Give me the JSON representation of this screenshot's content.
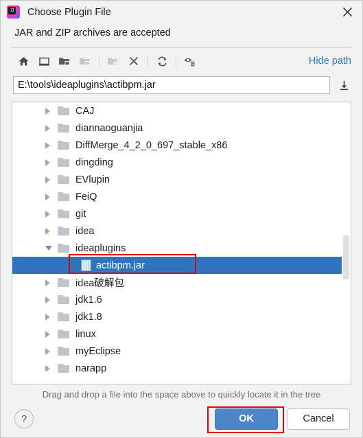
{
  "window": {
    "title": "Choose Plugin File",
    "logo_text": "IJ",
    "close_icon": "close-icon"
  },
  "subtitle": "JAR and ZIP archives are accepted",
  "toolbar": {
    "items": [
      {
        "icon": "home-icon",
        "label": "Home",
        "enabled": true
      },
      {
        "icon": "desktop-icon",
        "label": "Desktop",
        "enabled": true
      },
      {
        "icon": "folder-expand-icon",
        "label": "Expand All",
        "enabled": true
      },
      {
        "icon": "folder-collapse-icon",
        "label": "Collapse All",
        "enabled": false
      },
      {
        "icon": "new-folder-icon",
        "label": "New Folder",
        "enabled": false
      },
      {
        "icon": "delete-icon",
        "label": "Delete",
        "enabled": true
      },
      {
        "icon": "refresh-icon",
        "label": "Refresh",
        "enabled": true
      },
      {
        "icon": "show-hidden-files-icon",
        "label": "Show Hidden Files",
        "enabled": true
      }
    ],
    "hide_path_label": "Hide path"
  },
  "path_field": {
    "value": "E:\\tools\\ideaplugins\\actibpm.jar",
    "placeholder": "",
    "download_icon": "download-icon"
  },
  "tree": {
    "rows": [
      {
        "label": "CAJ",
        "type": "folder",
        "state": "collapsed",
        "indent": 0,
        "selected": false
      },
      {
        "label": "diannaoguanjia",
        "type": "folder",
        "state": "collapsed",
        "indent": 0,
        "selected": false
      },
      {
        "label": "DiffMerge_4_2_0_697_stable_x86",
        "type": "folder",
        "state": "collapsed",
        "indent": 0,
        "selected": false
      },
      {
        "label": "dingding",
        "type": "folder",
        "state": "collapsed",
        "indent": 0,
        "selected": false
      },
      {
        "label": "EVlupin",
        "type": "folder",
        "state": "collapsed",
        "indent": 0,
        "selected": false
      },
      {
        "label": "FeiQ",
        "type": "folder",
        "state": "collapsed",
        "indent": 0,
        "selected": false
      },
      {
        "label": "git",
        "type": "folder",
        "state": "collapsed",
        "indent": 0,
        "selected": false
      },
      {
        "label": "idea",
        "type": "folder",
        "state": "collapsed",
        "indent": 0,
        "selected": false
      },
      {
        "label": "ideaplugins",
        "type": "folder",
        "state": "expanded",
        "indent": 0,
        "selected": false
      },
      {
        "label": "actibpm.jar",
        "type": "jar",
        "state": "leaf",
        "indent": 1,
        "selected": true
      },
      {
        "label": "idea破解包",
        "type": "folder",
        "state": "collapsed",
        "indent": 0,
        "selected": false
      },
      {
        "label": "jdk1.6",
        "type": "folder",
        "state": "collapsed",
        "indent": 0,
        "selected": false
      },
      {
        "label": "jdk1.8",
        "type": "folder",
        "state": "collapsed",
        "indent": 0,
        "selected": false
      },
      {
        "label": "linux",
        "type": "folder",
        "state": "collapsed",
        "indent": 0,
        "selected": false
      },
      {
        "label": "myEclipse",
        "type": "folder",
        "state": "collapsed",
        "indent": 0,
        "selected": false
      },
      {
        "label": "narapp",
        "type": "folder",
        "state": "collapsed",
        "indent": 0,
        "selected": false
      }
    ],
    "scrollbar": {
      "name": "vertical-scrollbar"
    }
  },
  "hint": "Drag and drop a file into the space above to quickly locate it in the tree",
  "footer": {
    "help_label": "?",
    "ok_label": "OK",
    "cancel_label": "Cancel"
  },
  "annotations": [
    {
      "name": "annotation-box-selected-file",
      "color": "#e60000"
    },
    {
      "name": "annotation-box-ok-button",
      "color": "#e60000"
    }
  ],
  "colors": {
    "selection_blue": "#2f74be",
    "ok_button_blue": "#4a86c8",
    "link_blue": "#2979c4",
    "annotation_red": "#e60000",
    "dialog_bg": "#f2f2f2"
  }
}
